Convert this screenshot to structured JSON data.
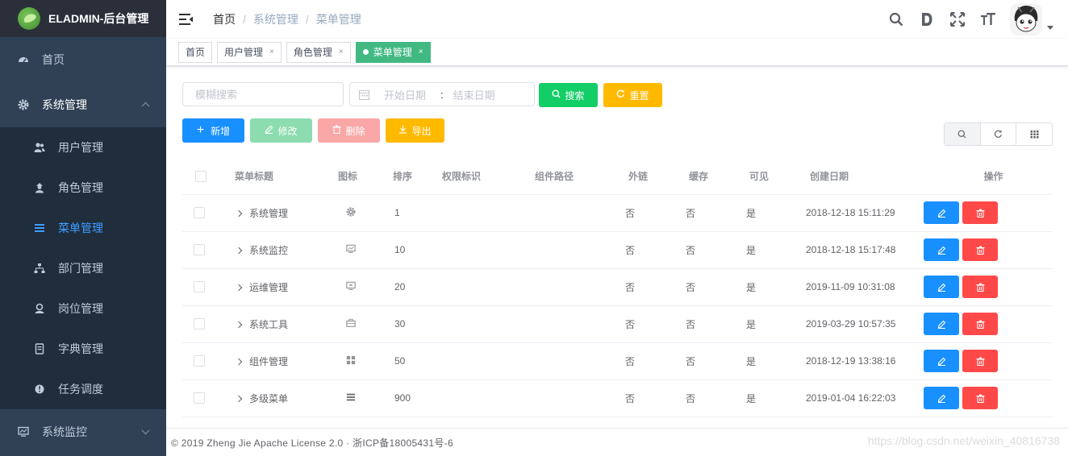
{
  "app": {
    "title": "ELADMIN-后台管理"
  },
  "sidebar": {
    "items": [
      {
        "label": "首页",
        "icon": "dashboard-icon"
      },
      {
        "label": "系统管理",
        "icon": "gear-icon",
        "expanded": true
      },
      {
        "label": "系统监控",
        "icon": "monitor-icon",
        "expanded": false
      }
    ],
    "sub_items": [
      {
        "label": "用户管理",
        "icon": "users-icon"
      },
      {
        "label": "角色管理",
        "icon": "role-icon"
      },
      {
        "label": "菜单管理",
        "icon": "menu-icon",
        "active": true
      },
      {
        "label": "部门管理",
        "icon": "tree-icon"
      },
      {
        "label": "岗位管理",
        "icon": "job-icon"
      },
      {
        "label": "字典管理",
        "icon": "dictionary-icon"
      },
      {
        "label": "任务调度",
        "icon": "timing-icon"
      }
    ]
  },
  "breadcrumb": [
    "首页",
    "系统管理",
    "菜单管理"
  ],
  "tags": [
    {
      "label": "首页",
      "closable": false
    },
    {
      "label": "用户管理",
      "closable": true
    },
    {
      "label": "角色管理",
      "closable": true
    },
    {
      "label": "菜单管理",
      "closable": true,
      "active": true
    }
  ],
  "tag_close": "×",
  "search": {
    "placeholder": "模糊搜索",
    "start_placeholder": "开始日期",
    "range_separator": ":",
    "end_placeholder": "结束日期",
    "search_label": "搜索",
    "reset_label": "重置"
  },
  "crud": {
    "add_label": "新增",
    "edit_label": "修改",
    "delete_label": "删除",
    "export_label": "导出"
  },
  "table": {
    "headers": [
      "菜单标题",
      "图标",
      "排序",
      "权限标识",
      "组件路径",
      "外链",
      "缓存",
      "可见",
      "创建日期",
      "操作"
    ],
    "rows": [
      {
        "title": "系统管理",
        "icon": "gear-icon",
        "sort": "1",
        "permission": "",
        "component": "",
        "iframe": "否",
        "cache": "否",
        "hidden": "是",
        "created": "2018-12-18 15:11:29"
      },
      {
        "title": "系统监控",
        "icon": "monitor-icon",
        "sort": "10",
        "permission": "",
        "component": "",
        "iframe": "否",
        "cache": "否",
        "hidden": "是",
        "created": "2018-12-18 15:17:48"
      },
      {
        "title": "运维管理",
        "icon": "mnt-icon",
        "sort": "20",
        "permission": "",
        "component": "",
        "iframe": "否",
        "cache": "否",
        "hidden": "是",
        "created": "2019-11-09 10:31:08"
      },
      {
        "title": "系统工具",
        "icon": "sys-tools-icon",
        "sort": "30",
        "permission": "",
        "component": "",
        "iframe": "否",
        "cache": "否",
        "hidden": "是",
        "created": "2019-03-29 10:57:35"
      },
      {
        "title": "组件管理",
        "icon": "zujian-icon",
        "sort": "50",
        "permission": "",
        "component": "",
        "iframe": "否",
        "cache": "否",
        "hidden": "是",
        "created": "2018-12-19 13:38:16"
      },
      {
        "title": "多级菜单",
        "icon": "menu-icon",
        "sort": "900",
        "permission": "",
        "component": "",
        "iframe": "否",
        "cache": "否",
        "hidden": "是",
        "created": "2019-01-04 16:22:03"
      }
    ]
  },
  "footer": {
    "text": "© 2019 Zheng Jie Apache License 2.0 · 浙ICP备18005431号-6"
  },
  "watermark": "https://blog.csdn.net/weixin_40816738",
  "colors": {
    "sidebar_bg": "#304156",
    "submenu_bg": "#1f2d3d",
    "active": "#409eff",
    "tag_active": "#42b983",
    "primary": "#1890ff",
    "success": "#13ce66",
    "warning": "#ffba00",
    "danger": "#ff4949"
  }
}
